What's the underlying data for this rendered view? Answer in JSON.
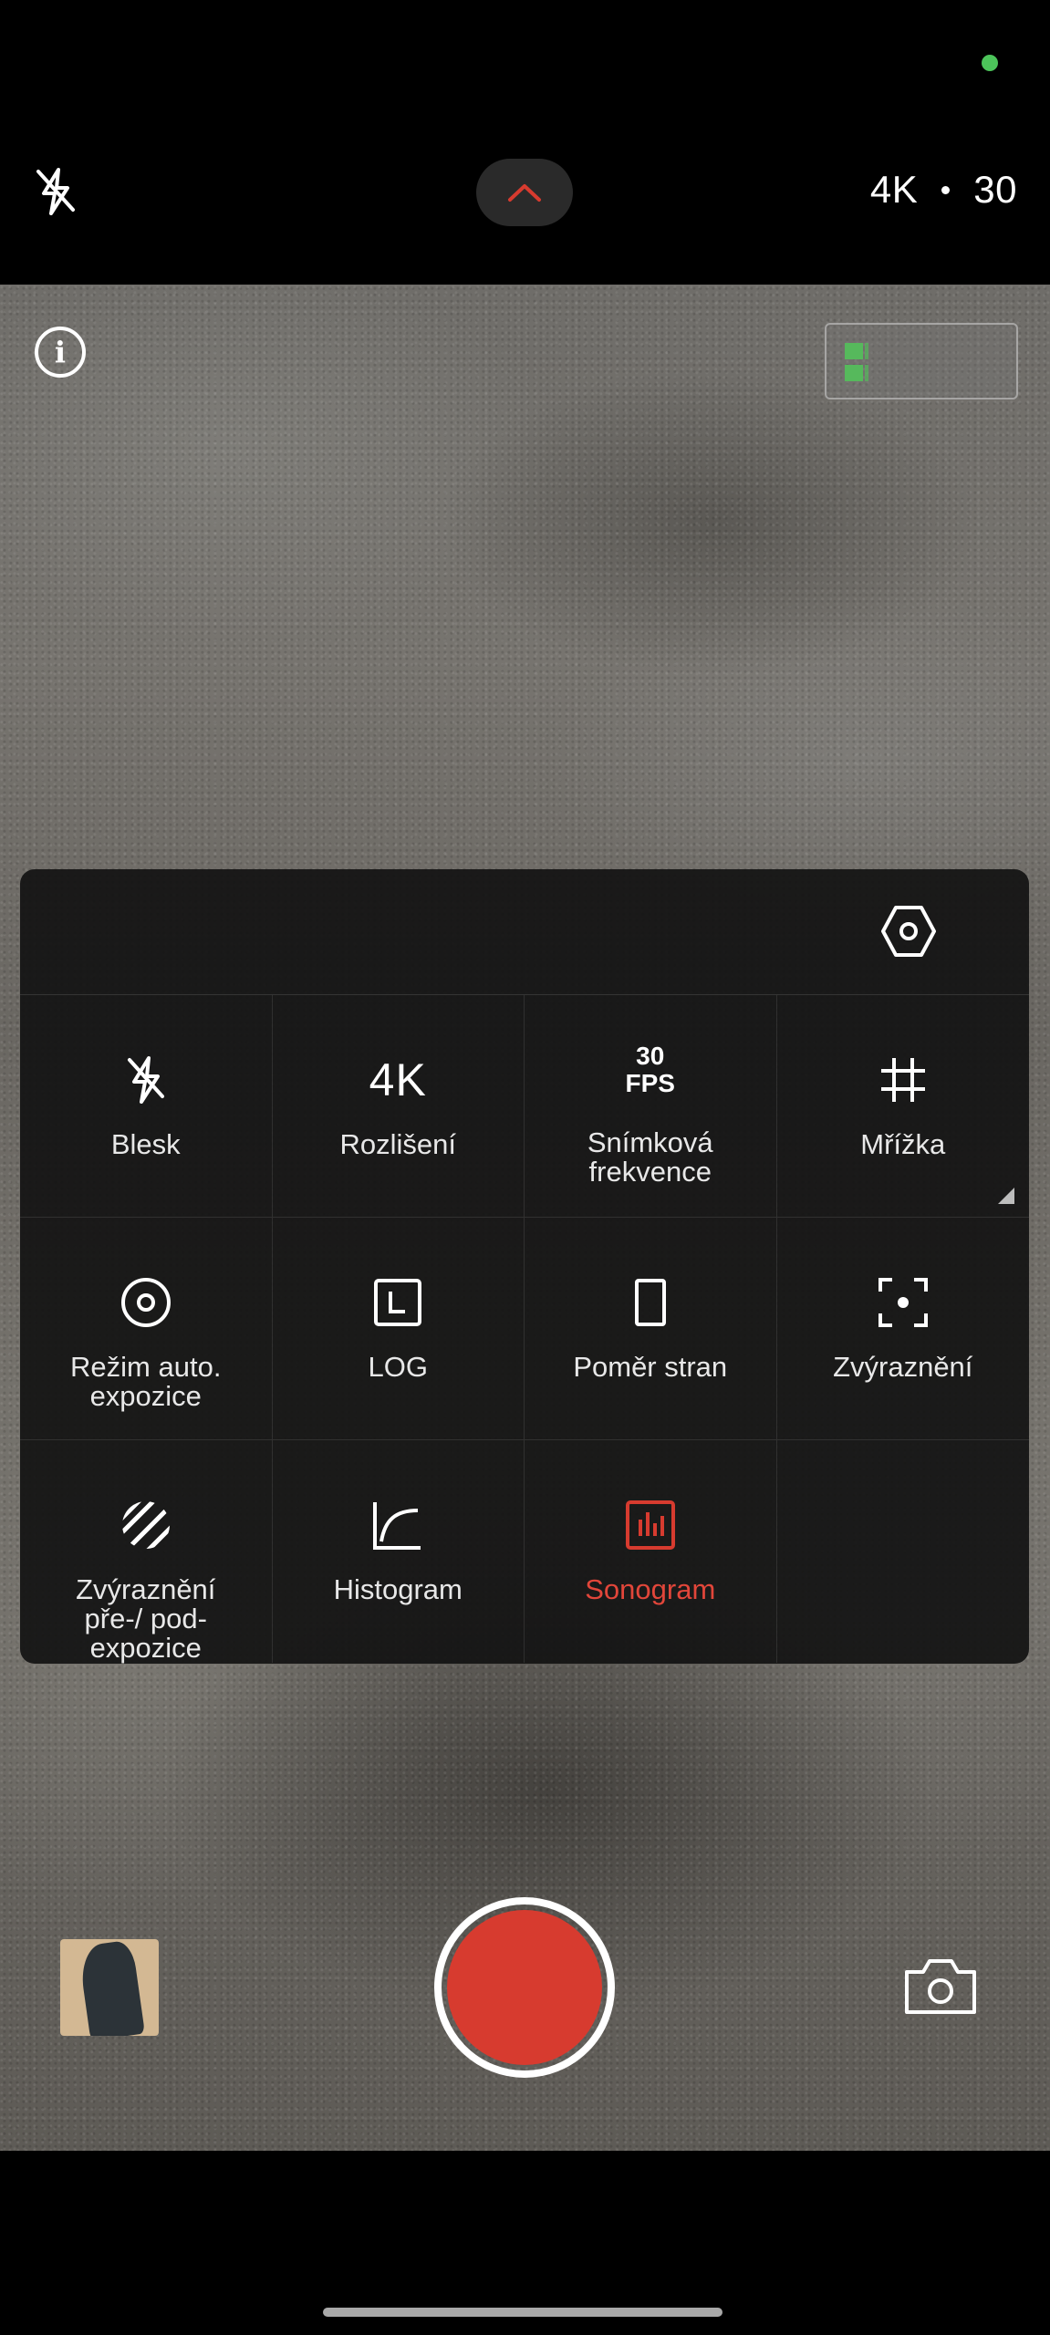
{
  "top_bar": {
    "resolution": "4K",
    "frame_rate": "30",
    "flash_icon": "flash-off-icon",
    "expand_icon": "chevron-up-icon",
    "accent_color": "#d73b2f"
  },
  "viewfinder": {
    "info_icon": "info-icon",
    "info_glyph": "i"
  },
  "quick_settings": {
    "settings_icon": "settings-hexagon-icon",
    "items": [
      {
        "label": "Blesk",
        "icon": "flash-off-icon"
      },
      {
        "label": "Rozlišení",
        "value": "4K"
      },
      {
        "label": "Snímková frekvence",
        "value_top": "30",
        "value_bottom": "FPS"
      },
      {
        "label": "Mřížka",
        "icon": "grid-icon"
      },
      {
        "label": "Režim auto. expozice",
        "icon": "auto-exposure-icon"
      },
      {
        "label": "LOG",
        "icon": "log-icon"
      },
      {
        "label": "Poměr stran",
        "icon": "aspect-ratio-icon"
      },
      {
        "label": "Zvýraznění",
        "icon": "focus-peaking-icon"
      },
      {
        "label": "Zvýraznění pře-/ pod-expozice",
        "icon": "zebra-icon"
      },
      {
        "label": "Histogram",
        "icon": "histogram-icon"
      },
      {
        "label": "Sonogram",
        "icon": "sonogram-icon",
        "active": true
      }
    ]
  },
  "bottom": {
    "gallery_icon": "gallery-thumbnail",
    "shutter_icon": "record-button",
    "switch_icon": "camera-icon"
  }
}
